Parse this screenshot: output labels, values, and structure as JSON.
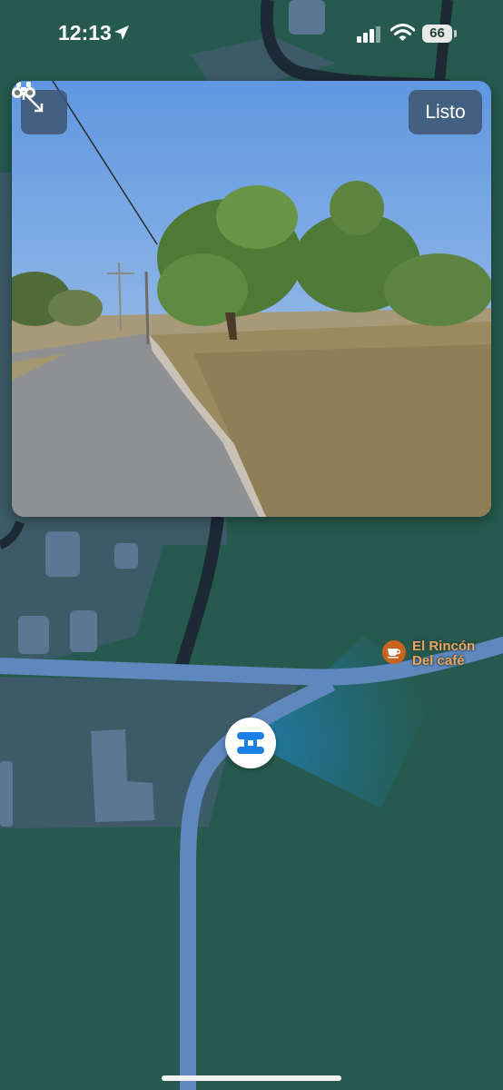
{
  "status_bar": {
    "time": "12:13",
    "battery": "66"
  },
  "look_around": {
    "done_label": "Listo",
    "expand_icon": "expand-arrows-icon",
    "binoculars_icon": "binoculars-icon"
  },
  "map": {
    "poi": {
      "name_line1": "El Rincón",
      "name_line2": "Del café",
      "icon": "coffee-cup-icon",
      "color": "#c9631d"
    },
    "viewpoint_icon": "binoculars-icon",
    "colors": {
      "land": "#265a4e",
      "built_area": "#3c5b67",
      "road": "#5f88bf",
      "building": "#5a7894"
    }
  }
}
